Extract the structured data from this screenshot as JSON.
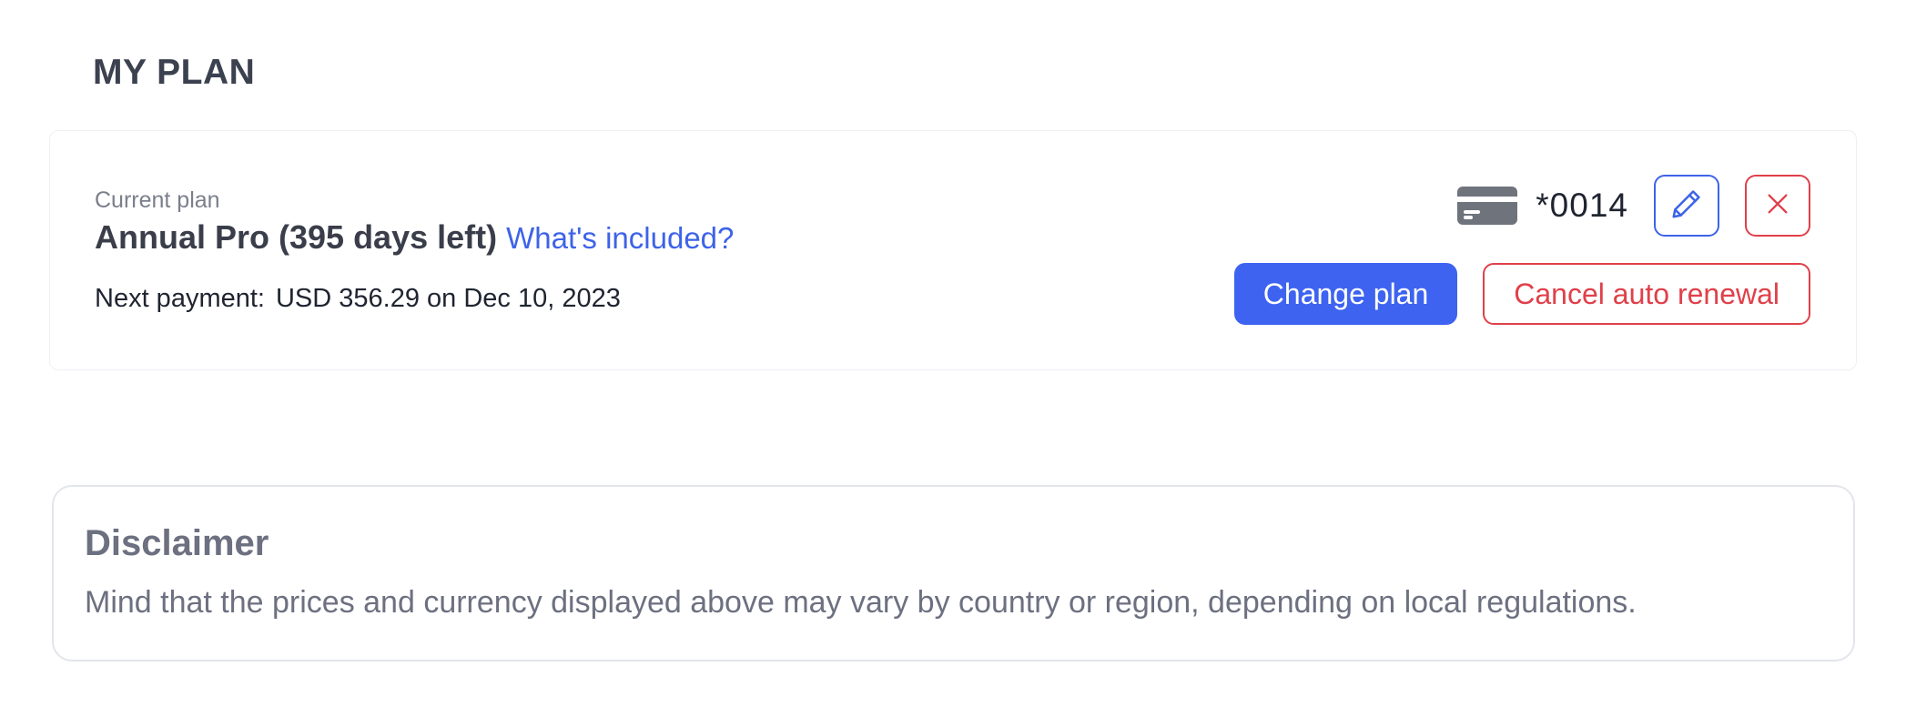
{
  "page": {
    "title": "MY PLAN"
  },
  "plan": {
    "caption": "Current plan",
    "name": "Annual Pro (395 days left)",
    "whats_included_link": "What's included?",
    "next_payment_label": "Next payment:",
    "next_payment_value": "USD 356.29 on Dec 10, 2023"
  },
  "payment_card": {
    "icon": "credit-card-icon",
    "last4": "*0014",
    "edit_icon": "pencil-icon",
    "remove_icon": "close-icon"
  },
  "actions": {
    "change_plan": "Change plan",
    "cancel_auto_renewal": "Cancel auto renewal"
  },
  "disclaimer": {
    "title": "Disclaimer",
    "text": "Mind that the prices and currency displayed above may vary by country or region, depending on local regulations."
  },
  "colors": {
    "accent": "#3d63f0",
    "link": "#3d63e8",
    "danger": "#e0404a",
    "muted_text": "#6c7080"
  }
}
